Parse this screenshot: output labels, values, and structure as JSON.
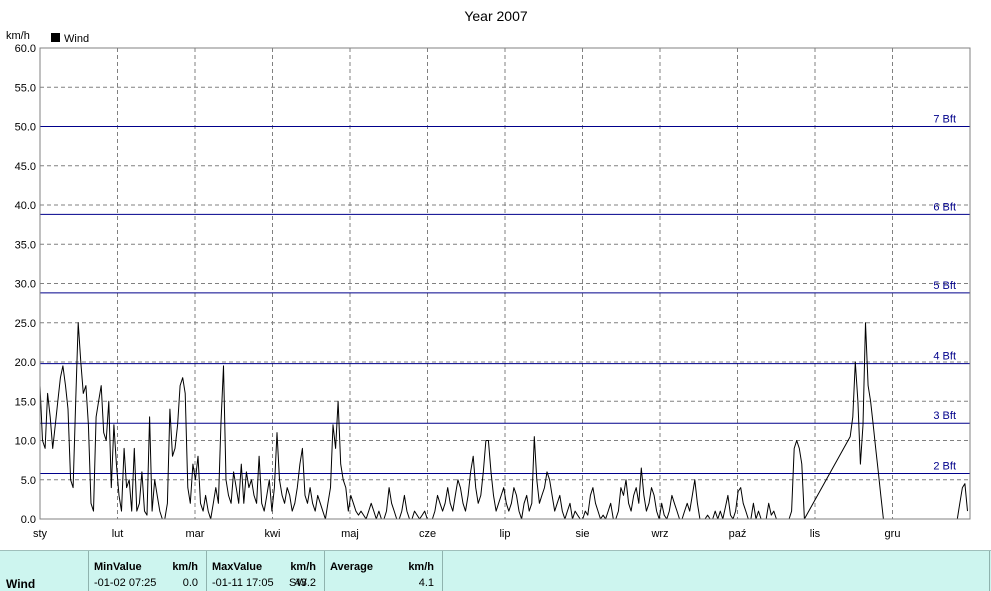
{
  "chart_data": {
    "type": "line",
    "title": "Year 2007",
    "ylabel": "km/h",
    "legend": "Wind",
    "legend_position": "top-left",
    "grid": true,
    "ylim": [
      0,
      60
    ],
    "yticks": [
      "0.0",
      "5.0",
      "10.0",
      "15.0",
      "20.0",
      "25.0",
      "30.0",
      "35.0",
      "40.0",
      "45.0",
      "50.0",
      "55.0",
      "60.0"
    ],
    "months": [
      "sty",
      "lut",
      "mar",
      "kwi",
      "maj",
      "cze",
      "lip",
      "sie",
      "wrz",
      "paź",
      "lis",
      "gru"
    ],
    "x_range_days": [
      0,
      365
    ],
    "colors": {
      "series": "#000000",
      "bft": "#00008b",
      "grid": "#808080"
    },
    "beaufort_lines": [
      {
        "label": "2 Bft",
        "value": 5.8
      },
      {
        "label": "3 Bft",
        "value": 12.2
      },
      {
        "label": "4 Bft",
        "value": 19.8
      },
      {
        "label": "5 Bft",
        "value": 28.8
      },
      {
        "label": "6 Bft",
        "value": 38.8
      },
      {
        "label": "7 Bft",
        "value": 50.0
      }
    ],
    "series": [
      {
        "name": "Wind",
        "points": [
          [
            0,
            17
          ],
          [
            1,
            10
          ],
          [
            2,
            9
          ],
          [
            3,
            16
          ],
          [
            4,
            13
          ],
          [
            5,
            9
          ],
          [
            6,
            12
          ],
          [
            7,
            15
          ],
          [
            8,
            18
          ],
          [
            9,
            19.5
          ],
          [
            10,
            17
          ],
          [
            11,
            14
          ],
          [
            12,
            5
          ],
          [
            13,
            4
          ],
          [
            14,
            15
          ],
          [
            15,
            25
          ],
          [
            16,
            20
          ],
          [
            17,
            16
          ],
          [
            18,
            17
          ],
          [
            19,
            12
          ],
          [
            20,
            2
          ],
          [
            21,
            1
          ],
          [
            22,
            13
          ],
          [
            23,
            15
          ],
          [
            24,
            17
          ],
          [
            25,
            11
          ],
          [
            26,
            10
          ],
          [
            27,
            15
          ],
          [
            28,
            4
          ],
          [
            29,
            12
          ],
          [
            30,
            7
          ],
          [
            31,
            3
          ],
          [
            32,
            1
          ],
          [
            33,
            9
          ],
          [
            34,
            4
          ],
          [
            35,
            5
          ],
          [
            36,
            1
          ],
          [
            37,
            9
          ],
          [
            38,
            1
          ],
          [
            39,
            2
          ],
          [
            40,
            6
          ],
          [
            41,
            1
          ],
          [
            42,
            0.5
          ],
          [
            43,
            13
          ],
          [
            44,
            1
          ],
          [
            45,
            5
          ],
          [
            46,
            3
          ],
          [
            47,
            1
          ],
          [
            48,
            0
          ],
          [
            49,
            0
          ],
          [
            50,
            2
          ],
          [
            51,
            14
          ],
          [
            52,
            8
          ],
          [
            53,
            9
          ],
          [
            54,
            12
          ],
          [
            55,
            17
          ],
          [
            56,
            18
          ],
          [
            57,
            16
          ],
          [
            58,
            4
          ],
          [
            59,
            2
          ],
          [
            60,
            7
          ],
          [
            61,
            5
          ],
          [
            62,
            8
          ],
          [
            63,
            2
          ],
          [
            64,
            1
          ],
          [
            65,
            3
          ],
          [
            66,
            1
          ],
          [
            67,
            0
          ],
          [
            68,
            2
          ],
          [
            69,
            4
          ],
          [
            70,
            2
          ],
          [
            71,
            12
          ],
          [
            72,
            19.5
          ],
          [
            73,
            5
          ],
          [
            74,
            3
          ],
          [
            75,
            2
          ],
          [
            76,
            6
          ],
          [
            77,
            4
          ],
          [
            78,
            2
          ],
          [
            79,
            7
          ],
          [
            80,
            2
          ],
          [
            81,
            6
          ],
          [
            82,
            4
          ],
          [
            83,
            5
          ],
          [
            84,
            3
          ],
          [
            85,
            2
          ],
          [
            86,
            8
          ],
          [
            87,
            2
          ],
          [
            88,
            1
          ],
          [
            89,
            3
          ],
          [
            90,
            5
          ],
          [
            91,
            1
          ],
          [
            92,
            4
          ],
          [
            93,
            11
          ],
          [
            94,
            5
          ],
          [
            95,
            3
          ],
          [
            96,
            2
          ],
          [
            97,
            4
          ],
          [
            98,
            3
          ],
          [
            99,
            1
          ],
          [
            100,
            2
          ],
          [
            101,
            4
          ],
          [
            102,
            7
          ],
          [
            103,
            9
          ],
          [
            104,
            3
          ],
          [
            105,
            2
          ],
          [
            106,
            4
          ],
          [
            107,
            2
          ],
          [
            108,
            1
          ],
          [
            109,
            3
          ],
          [
            110,
            2
          ],
          [
            111,
            1
          ],
          [
            112,
            0
          ],
          [
            113,
            2
          ],
          [
            114,
            4
          ],
          [
            115,
            12
          ],
          [
            116,
            9
          ],
          [
            117,
            15
          ],
          [
            118,
            7
          ],
          [
            119,
            5
          ],
          [
            120,
            4
          ],
          [
            121,
            1
          ],
          [
            122,
            3
          ],
          [
            123,
            2
          ],
          [
            124,
            1
          ],
          [
            125,
            0.5
          ],
          [
            126,
            1
          ],
          [
            127,
            0.5
          ],
          [
            128,
            0
          ],
          [
            129,
            1
          ],
          [
            130,
            2
          ],
          [
            131,
            1
          ],
          [
            132,
            0
          ],
          [
            133,
            1
          ],
          [
            134,
            0
          ],
          [
            135,
            0
          ],
          [
            136,
            1
          ],
          [
            137,
            4
          ],
          [
            138,
            2
          ],
          [
            139,
            1
          ],
          [
            140,
            0
          ],
          [
            141,
            0
          ],
          [
            142,
            1
          ],
          [
            143,
            3
          ],
          [
            144,
            1
          ],
          [
            145,
            0
          ],
          [
            146,
            0
          ],
          [
            147,
            1
          ],
          [
            148,
            0.5
          ],
          [
            149,
            0
          ],
          [
            150,
            0.5
          ],
          [
            151,
            1
          ],
          [
            152,
            0
          ],
          [
            153,
            0
          ],
          [
            154,
            0
          ],
          [
            155,
            1
          ],
          [
            156,
            3
          ],
          [
            157,
            2
          ],
          [
            158,
            1
          ],
          [
            159,
            2
          ],
          [
            160,
            4
          ],
          [
            161,
            2
          ],
          [
            162,
            1
          ],
          [
            163,
            3
          ],
          [
            164,
            5
          ],
          [
            165,
            4
          ],
          [
            166,
            2
          ],
          [
            167,
            1
          ],
          [
            168,
            3
          ],
          [
            169,
            6
          ],
          [
            170,
            8
          ],
          [
            171,
            4
          ],
          [
            172,
            2
          ],
          [
            173,
            3
          ],
          [
            174,
            6
          ],
          [
            175,
            10
          ],
          [
            176,
            10
          ],
          [
            177,
            6
          ],
          [
            178,
            3
          ],
          [
            179,
            1
          ],
          [
            180,
            2
          ],
          [
            181,
            3
          ],
          [
            182,
            4
          ],
          [
            183,
            2
          ],
          [
            184,
            1
          ],
          [
            185,
            2
          ],
          [
            186,
            4
          ],
          [
            187,
            3
          ],
          [
            188,
            1
          ],
          [
            189,
            0
          ],
          [
            190,
            2
          ],
          [
            191,
            3
          ],
          [
            192,
            1
          ],
          [
            193,
            2
          ],
          [
            194,
            10.5
          ],
          [
            195,
            5
          ],
          [
            196,
            2
          ],
          [
            197,
            3
          ],
          [
            198,
            4
          ],
          [
            199,
            6
          ],
          [
            200,
            5
          ],
          [
            201,
            3
          ],
          [
            202,
            1
          ],
          [
            203,
            2
          ],
          [
            204,
            3
          ],
          [
            205,
            1
          ],
          [
            206,
            0
          ],
          [
            207,
            1
          ],
          [
            208,
            2
          ],
          [
            209,
            0
          ],
          [
            210,
            1
          ],
          [
            211,
            0.5
          ],
          [
            212,
            0
          ],
          [
            213,
            0
          ],
          [
            214,
            1
          ],
          [
            215,
            0.5
          ],
          [
            216,
            3
          ],
          [
            217,
            4
          ],
          [
            218,
            2
          ],
          [
            219,
            1
          ],
          [
            220,
            0
          ],
          [
            221,
            0.5
          ],
          [
            222,
            0
          ],
          [
            223,
            1
          ],
          [
            224,
            2
          ],
          [
            225,
            0
          ],
          [
            226,
            0
          ],
          [
            227,
            1
          ],
          [
            228,
            4
          ],
          [
            229,
            3
          ],
          [
            230,
            5
          ],
          [
            231,
            2
          ],
          [
            232,
            1
          ],
          [
            233,
            3
          ],
          [
            234,
            4
          ],
          [
            235,
            2
          ],
          [
            236,
            6.5
          ],
          [
            237,
            3
          ],
          [
            238,
            1
          ],
          [
            239,
            2
          ],
          [
            240,
            4
          ],
          [
            241,
            3
          ],
          [
            242,
            1
          ],
          [
            243,
            0
          ],
          [
            244,
            2
          ],
          [
            245,
            0.5
          ],
          [
            246,
            0
          ],
          [
            247,
            1
          ],
          [
            248,
            3
          ],
          [
            249,
            2
          ],
          [
            250,
            1
          ],
          [
            251,
            0
          ],
          [
            252,
            0
          ],
          [
            253,
            1
          ],
          [
            254,
            2
          ],
          [
            255,
            1
          ],
          [
            256,
            3
          ],
          [
            257,
            5
          ],
          [
            258,
            2
          ],
          [
            259,
            0
          ],
          [
            260,
            0
          ],
          [
            261,
            0
          ],
          [
            262,
            0.5
          ],
          [
            263,
            0
          ],
          [
            264,
            0
          ],
          [
            265,
            1
          ],
          [
            266,
            0
          ],
          [
            267,
            1
          ],
          [
            268,
            0
          ],
          [
            269,
            1.5
          ],
          [
            270,
            3
          ],
          [
            271,
            0.5
          ],
          [
            272,
            0
          ],
          [
            273,
            1
          ],
          [
            274,
            3.5
          ],
          [
            275,
            4
          ],
          [
            276,
            2
          ],
          [
            277,
            1
          ],
          [
            278,
            0
          ],
          [
            279,
            0
          ],
          [
            280,
            2
          ],
          [
            281,
            0
          ],
          [
            282,
            1
          ],
          [
            283,
            0
          ],
          [
            284,
            0
          ],
          [
            285,
            0
          ],
          [
            286,
            2
          ],
          [
            287,
            0.5
          ],
          [
            288,
            1
          ],
          [
            289,
            0
          ],
          [
            290,
            0
          ],
          [
            291,
            0
          ],
          [
            292,
            0
          ],
          [
            293,
            0
          ],
          [
            294,
            0
          ],
          [
            295,
            1
          ],
          [
            296,
            9
          ],
          [
            297,
            10
          ],
          [
            298,
            9
          ],
          [
            299,
            7
          ],
          [
            300,
            0
          ],
          [
            318,
            10.5
          ],
          [
            319,
            13
          ],
          [
            320,
            20
          ],
          [
            321,
            15
          ],
          [
            322,
            7
          ],
          [
            323,
            12
          ],
          [
            324,
            25
          ],
          [
            325,
            17
          ],
          [
            326,
            15
          ],
          [
            327,
            12
          ],
          [
            328,
            9
          ],
          [
            329,
            6
          ],
          [
            330,
            3
          ],
          [
            331,
            0
          ],
          [
            360,
            0
          ],
          [
            361,
            2
          ],
          [
            362,
            4
          ],
          [
            363,
            4.5
          ],
          [
            364,
            1
          ]
        ]
      }
    ]
  },
  "stats": {
    "row_label": "Wind",
    "min": {
      "header": "MinValue",
      "unit": "km/h",
      "time": "-01-02  07:25",
      "value": "0.0"
    },
    "max": {
      "header": "MaxValue",
      "unit": "km/h",
      "time": "-01-11  17:05",
      "dir": "SW",
      "value": "43.2"
    },
    "avg": {
      "header": "Average",
      "unit": "km/h",
      "value": "4.1"
    }
  }
}
